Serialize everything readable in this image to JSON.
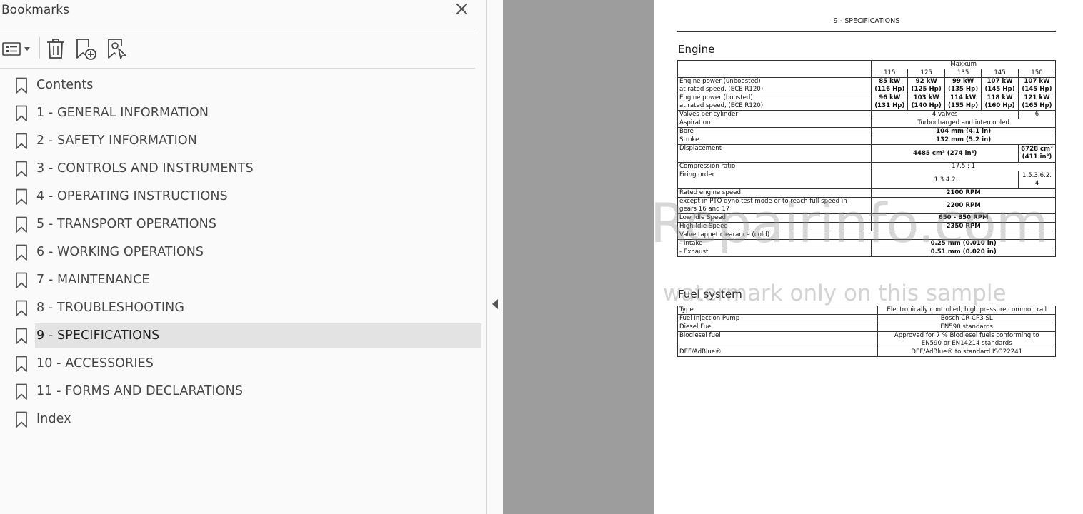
{
  "sidebar": {
    "title": "Bookmarks",
    "items": [
      {
        "label": "Contents"
      },
      {
        "label": "1 - GENERAL INFORMATION"
      },
      {
        "label": "2 - SAFETY INFORMATION"
      },
      {
        "label": "3 - CONTROLS AND INSTRUMENTS"
      },
      {
        "label": "4 - OPERATING INSTRUCTIONS"
      },
      {
        "label": "5 - TRANSPORT OPERATIONS"
      },
      {
        "label": "6 - WORKING OPERATIONS"
      },
      {
        "label": "7 - MAINTENANCE"
      },
      {
        "label": "8 - TROUBLESHOOTING"
      },
      {
        "label": "9 - SPECIFICATIONS",
        "selected": true
      },
      {
        "label": "10 - ACCESSORIES"
      },
      {
        "label": "11 - FORMS AND DECLARATIONS"
      },
      {
        "label": "Index"
      }
    ]
  },
  "page": {
    "header": "9 - SPECIFICATIONS",
    "engine_title": "Engine",
    "fuel_title": "Fuel system",
    "engine": {
      "group": "Maxxum",
      "models": [
        "115",
        "125",
        "135",
        "145",
        "150"
      ],
      "power_unboosted": {
        "label1": "Engine power (unboosted)",
        "label2": "at rated speed, (ECE R120)",
        "kw": [
          "85 kW",
          "92 kW",
          "99 kW",
          "107 kW",
          "107 kW"
        ],
        "hp": [
          "(116 Hp)",
          "(125 Hp)",
          "(135 Hp)",
          "(145 Hp)",
          "(145 Hp)"
        ]
      },
      "power_boosted": {
        "label1": "Engine power (boosted)",
        "label2": "at rated speed, (ECE R120)",
        "kw": [
          "96 kW",
          "103 kW",
          "114 kW",
          "118 kW",
          "121 kW"
        ],
        "hp": [
          "(131 Hp)",
          "(140 Hp)",
          "(155 Hp)",
          "(160 Hp)",
          "(165 Hp)"
        ]
      },
      "valves": {
        "label": "Valves per cylinder",
        "v1": "4 valves",
        "v2": "6"
      },
      "aspiration": {
        "label": "Aspiration",
        "value": "Turbocharged and intercooled"
      },
      "bore": {
        "label": "Bore",
        "value": "104 mm (4.1 in)"
      },
      "stroke": {
        "label": "Stroke",
        "value": "132 mm (5.2 in)"
      },
      "displacement": {
        "label": "Displacement",
        "v1": "4485 cm³ (274 in³)",
        "v2a": "6728 cm³",
        "v2b": "(411 in³)"
      },
      "compression": {
        "label": "Compression ratio",
        "value": "17.5 : 1"
      },
      "firing": {
        "label": "Firing order",
        "v1": "1.3.4.2",
        "v2a": "1.5.3.6.2.",
        "v2b": "4"
      },
      "rated_speed": {
        "label": "Rated engine speed",
        "value": "2100 RPM"
      },
      "pto": {
        "label1": "except in PTO dyno test mode or to reach full speed in",
        "label2": "gears 16 and 17",
        "value": "2200 RPM"
      },
      "low_idle": {
        "label": "Low Idle Speed",
        "value": "650 - 850 RPM"
      },
      "high_idle": {
        "label": "High Idle Speed",
        "value": "2350 RPM"
      },
      "valve_tappet": {
        "label": "Valve tappet clearance (cold)"
      },
      "intake": {
        "label": "- Intake",
        "value": "0.25 mm (0.010 in)"
      },
      "exhaust": {
        "label": "- Exhaust",
        "value": "0.51 mm (0.020 in)"
      }
    },
    "fuel": {
      "type": {
        "label": "Type",
        "value": "Electronically controlled, high pressure common rail"
      },
      "pump": {
        "label": "Fuel Injection Pump",
        "value": "Bosch CR-CP3 SL"
      },
      "diesel": {
        "label": "Diesel Fuel",
        "value": "EN590 standards"
      },
      "biodiesel": {
        "label": "Biodiesel fuel",
        "value1": "Approved for 7 % Biodiesel fuels conforming to",
        "value2": "EN590 or EN14214 standards"
      },
      "def": {
        "label": "DEF/AdBlue®",
        "value": "DEF/AdBlue® to standard ISO22241"
      }
    },
    "watermark1": "eRepairinfo.com",
    "watermark2": "watermark only on this sample"
  }
}
